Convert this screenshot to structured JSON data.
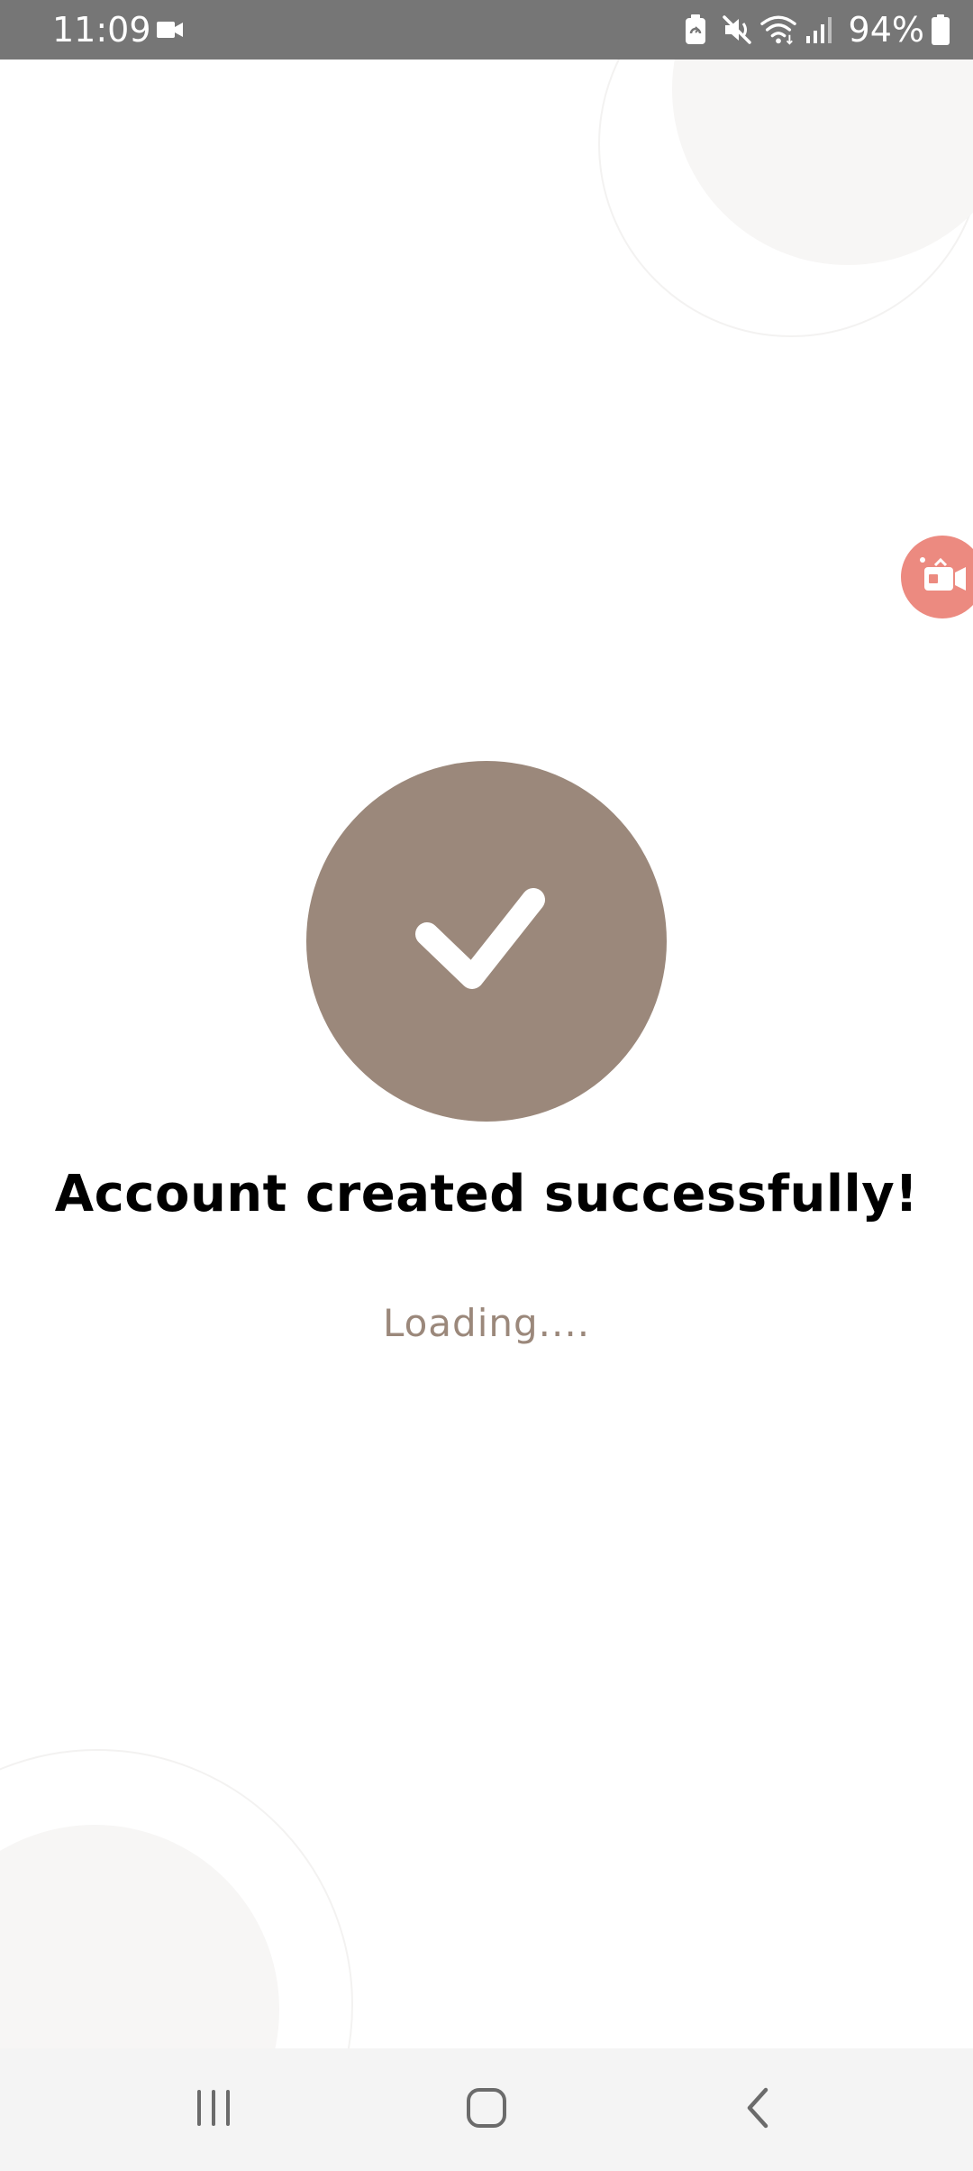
{
  "status_bar": {
    "time": "11:09",
    "battery_percent": "94%",
    "icons": [
      "video-recording-icon",
      "battery-saver-icon",
      "mute-icon",
      "wifi-icon",
      "signal-icon",
      "battery-icon"
    ]
  },
  "floating_button": {
    "icon": "screen-record-icon",
    "color": "#ec8a80"
  },
  "success": {
    "icon": "checkmark-icon",
    "circle_color": "#9b887b",
    "title": "Account created successfully!",
    "loading": "Loading...."
  },
  "nav_bar": {
    "buttons": [
      "recents",
      "home",
      "back"
    ]
  }
}
